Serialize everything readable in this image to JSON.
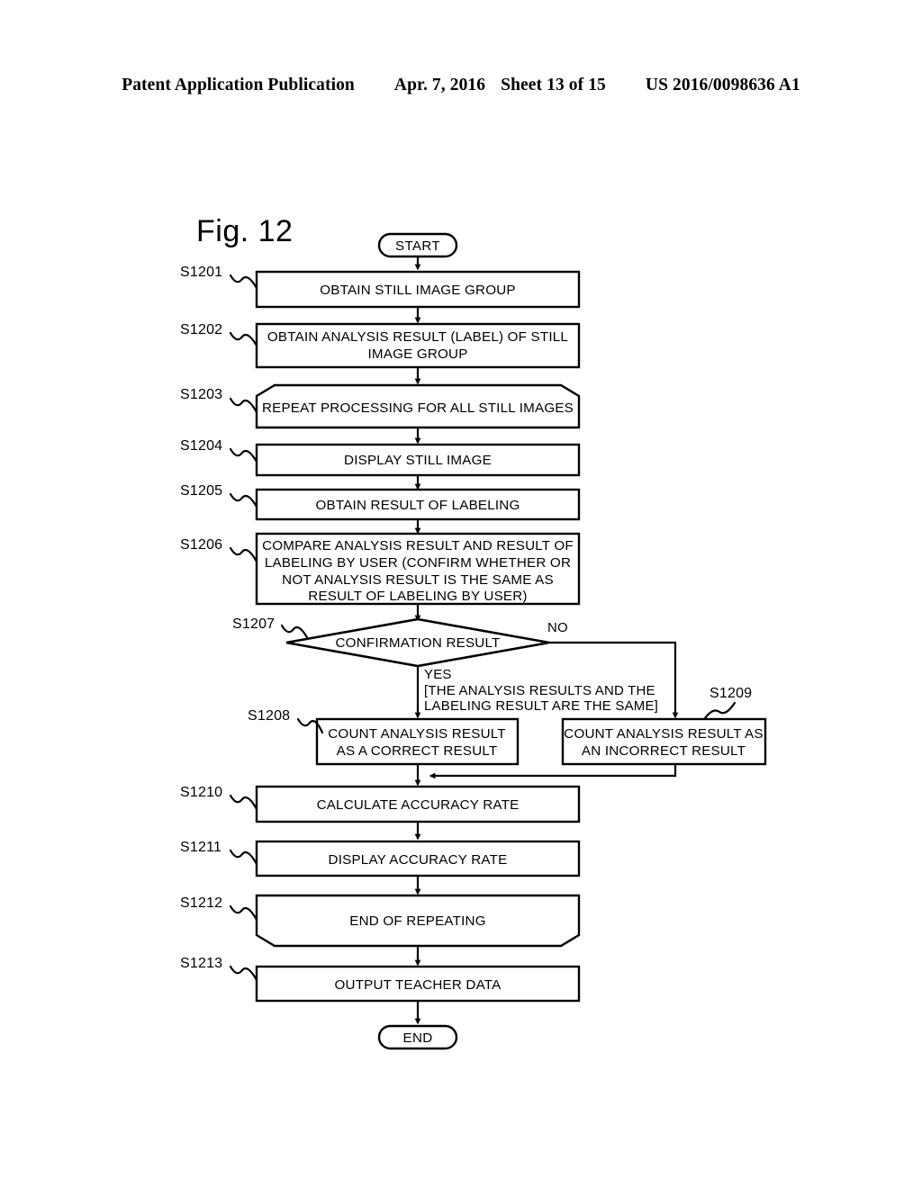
{
  "header": {
    "publication": "Patent Application Publication",
    "date": "Apr. 7, 2016",
    "sheet": "Sheet 13 of 15",
    "number": "US 2016/0098636 A1"
  },
  "figure": {
    "title": "Fig. 12"
  },
  "flowchart": {
    "start_label": "START",
    "end_label": "END",
    "steps": [
      {
        "id": "S1201",
        "ref": "S1201",
        "shape": "process",
        "lines": [
          "OBTAIN STILL IMAGE GROUP"
        ]
      },
      {
        "id": "S1202",
        "ref": "S1202",
        "shape": "process",
        "lines": [
          "OBTAIN ANALYSIS RESULT (LABEL) OF STILL",
          "IMAGE GROUP"
        ]
      },
      {
        "id": "S1203",
        "ref": "S1203",
        "shape": "loop-start",
        "lines": [
          "REPEAT PROCESSING FOR ALL STILL IMAGES"
        ]
      },
      {
        "id": "S1204",
        "ref": "S1204",
        "shape": "process",
        "lines": [
          "DISPLAY STILL IMAGE"
        ]
      },
      {
        "id": "S1205",
        "ref": "S1205",
        "shape": "process",
        "lines": [
          "OBTAIN RESULT OF LABELING"
        ]
      },
      {
        "id": "S1206",
        "ref": "S1206",
        "shape": "process",
        "lines": [
          "COMPARE ANALYSIS RESULT AND RESULT OF",
          "LABELING BY USER (CONFIRM WHETHER OR",
          "NOT ANALYSIS RESULT IS THE SAME AS",
          "RESULT OF LABELING BY USER)"
        ]
      },
      {
        "id": "S1207",
        "ref": "S1207",
        "shape": "decision",
        "lines": [
          "CONFIRMATION RESULT"
        ]
      },
      {
        "id": "S1208",
        "ref": "S1208",
        "shape": "process",
        "lines": [
          "COUNT ANALYSIS RESULT",
          "AS A CORRECT RESULT"
        ]
      },
      {
        "id": "S1209",
        "ref": "S1209",
        "shape": "process",
        "lines": [
          "COUNT ANALYSIS RESULT AS",
          "AN INCORRECT RESULT"
        ]
      },
      {
        "id": "S1210",
        "ref": "S1210",
        "shape": "process",
        "lines": [
          "CALCULATE ACCURACY RATE"
        ]
      },
      {
        "id": "S1211",
        "ref": "S1211",
        "shape": "process",
        "lines": [
          "DISPLAY ACCURACY RATE"
        ]
      },
      {
        "id": "S1212",
        "ref": "S1212",
        "shape": "loop-end",
        "lines": [
          "END OF REPEATING"
        ]
      },
      {
        "id": "S1213",
        "ref": "S1213",
        "shape": "process",
        "lines": [
          "OUTPUT TEACHER DATA"
        ]
      }
    ],
    "branches": {
      "no_label": "NO",
      "yes_label": "YES",
      "yes_note_line1": "[THE ANALYSIS RESULTS AND THE",
      "yes_note_line2": "LABELING RESULT ARE THE SAME]"
    }
  },
  "colors": {
    "ink": "#000000",
    "paper": "#ffffff"
  }
}
